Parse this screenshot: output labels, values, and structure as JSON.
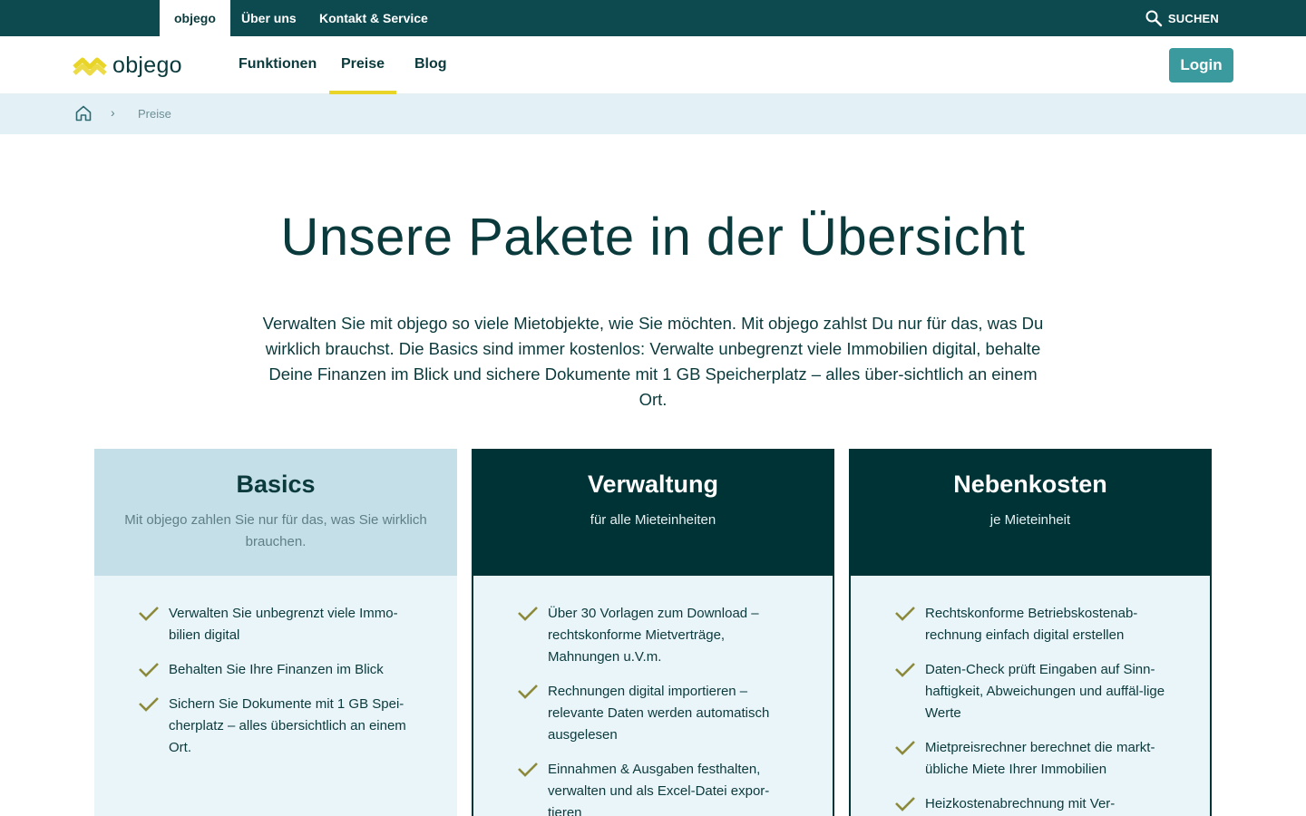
{
  "topbar": {
    "tabs": [
      "objego",
      "Über uns",
      "Kontakt & Service"
    ],
    "search_label": "SUCHEN"
  },
  "header": {
    "logo_text": "objego",
    "nav": [
      "Funktionen",
      "Preise",
      "Blog"
    ],
    "active_nav": "Preise",
    "login_label": "Login"
  },
  "breadcrumb": {
    "current": "Preise"
  },
  "hero": {
    "title": "Unsere Pakete in der Übersicht",
    "text": "Verwalten Sie mit objego so viele Mietobjekte, wie Sie möchten. Mit objego zahlst Du nur für das, was Du wirklich brauchst. Die Basics sind immer kostenlos: Verwalte unbegrenzt viele Immobilien digital, behalte Deine Finanzen im Blick und sichere Dokumente mit 1 GB Speicherplatz – alles über-sichtlich an einem Ort."
  },
  "cards": [
    {
      "name": "Basics",
      "subtitle": "Mit objego zahlen Sie nur für das, was Sie wirklich brauchen.",
      "features": [
        "Verwalten Sie unbegrenzt viele Immo-bilien digital",
        "Behalten Sie Ihre Finanzen im Blick",
        "Sichern Sie Dokumente mit 1 GB Spei-cherplatz – alles übersichtlich an einem Ort."
      ]
    },
    {
      "name": "Verwaltung",
      "subtitle": "für alle Mieteinheiten",
      "features": [
        "Über 30 Vorlagen zum Download – rechtskonforme Mietverträge, Mahnungen u.V.m.",
        "Rechnungen digital importieren – relevante Daten werden automatisch ausgelesen",
        "Einnahmen & Ausgaben festhalten, verwalten und als Excel-Datei expor-tieren"
      ]
    },
    {
      "name": "Nebenkosten",
      "subtitle": "je Mieteinheit",
      "features": [
        "Rechtskonforme Betriebskostenab-rechnung einfach digital erstellen",
        "Daten-Check prüft Eingaben auf Sinn-haftigkeit, Abweichungen und auffäl-lige Werte",
        "Mietpreisrechner berechnet die markt-übliche Miete Ihrer Immobilien",
        "Heizkostenabrechnung mit Ver-"
      ]
    }
  ],
  "colors": {
    "topbar": "#0d4a4f",
    "accent_yellow": "#e9d527",
    "login_button": "#3a9a9e",
    "dark_card": "#003336",
    "light_card_head": "#c5dfe8",
    "card_body": "#eaf5fa",
    "check": "#8c8a3a"
  }
}
